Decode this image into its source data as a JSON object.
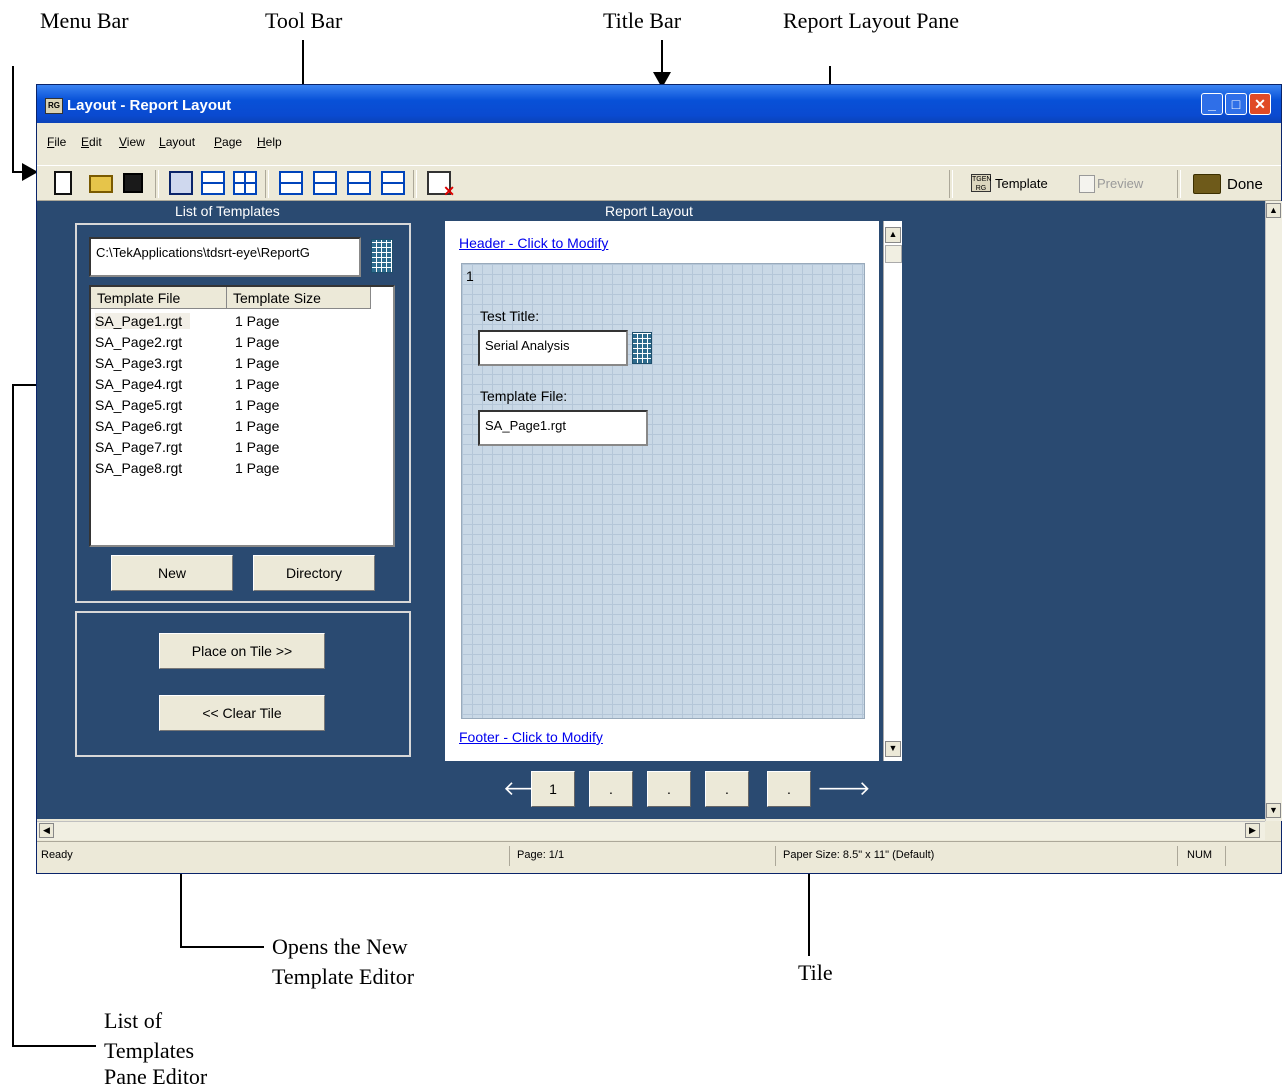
{
  "annotations": {
    "menu_bar": "Menu Bar",
    "tool_bar": "Tool Bar",
    "title_bar": "Title Bar",
    "report_layout_pane": "Report Layout Pane",
    "new_editor_line1": "Opens the New",
    "new_editor_line2": "Template Editor",
    "tile": "Tile",
    "list_pane_line1": "List of",
    "list_pane_line2": "Templates",
    "list_pane_line3": "Pane Editor"
  },
  "window": {
    "title": "Layout - Report Layout",
    "app_icon_text": "RG",
    "buttons": {
      "minimize": "_",
      "maximize": "□",
      "close": "✕"
    }
  },
  "menu": [
    "File",
    "Edit",
    "View",
    "Layout",
    "Page",
    "Help"
  ],
  "toolbar": {
    "template_label": "Template",
    "template_icon_text": "TGEN RG",
    "preview_label": "Preview",
    "done_label": "Done"
  },
  "templates_panel": {
    "title": "List of Templates",
    "directory_path": "C:\\TekApplications\\tdsrt-eye\\ReportG",
    "columns": [
      "Template File",
      "Template Size"
    ],
    "rows": [
      {
        "file": "SA_Page1.rgt",
        "size": "1 Page"
      },
      {
        "file": "SA_Page2.rgt",
        "size": "1 Page"
      },
      {
        "file": "SA_Page3.rgt",
        "size": "1 Page"
      },
      {
        "file": "SA_Page4.rgt",
        "size": "1 Page"
      },
      {
        "file": "SA_Page5.rgt",
        "size": "1 Page"
      },
      {
        "file": "SA_Page6.rgt",
        "size": "1 Page"
      },
      {
        "file": "SA_Page7.rgt",
        "size": "1 Page"
      },
      {
        "file": "SA_Page8.rgt",
        "size": "1 Page"
      }
    ],
    "new_button": "New",
    "directory_button": "Directory",
    "place_button": "Place on Tile >>",
    "clear_button": "<< Clear Tile"
  },
  "report_layout": {
    "title": "Report Layout",
    "header_link": "Header - Click to Modify",
    "footer_link": "Footer - Click to Modify",
    "tile_number": "1",
    "test_title_label": "Test Title:",
    "test_title_value": "Serial Analysis",
    "template_file_label": "Template File:",
    "template_file_value": "SA_Page1.rgt",
    "pages": [
      "1",
      ".",
      ".",
      ".",
      "."
    ]
  },
  "status": {
    "ready": "Ready",
    "page": "Page:   1/1",
    "paper": "Paper Size: 8.5\" x 11\" (Default)",
    "num": "NUM"
  },
  "icons": {
    "prev_page": "arrow-left-icon",
    "next_page": "arrow-right-icon"
  }
}
